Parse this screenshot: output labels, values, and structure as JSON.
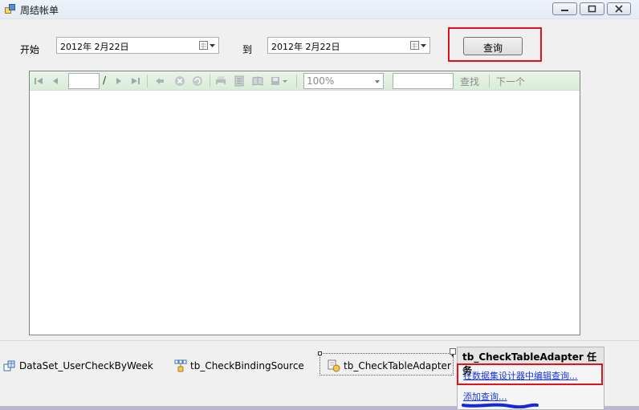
{
  "window": {
    "title": "周结帐单",
    "min_icon": "minimize-icon",
    "max_icon": "maximize-icon",
    "close_icon": "close-icon"
  },
  "filter": {
    "start_label": "开始",
    "start_date": "2012年  2月22日",
    "to_label": "到",
    "end_date": "2012年  2月22日",
    "query_button": "查询"
  },
  "report_viewer": {
    "page_number": "",
    "page_separator": "/",
    "zoom": "100%",
    "find_text": "",
    "find_label": "查找",
    "next_label": "下一个",
    "toolbar_icons": [
      "first-page-icon",
      "prev-page-icon",
      "next-page-icon",
      "last-page-icon",
      "back-icon",
      "stop-icon",
      "refresh-icon",
      "print-icon",
      "print-layout-icon",
      "page-setup-icon",
      "export-icon"
    ]
  },
  "tray": {
    "components": [
      "DataSet_UserCheckByWeek",
      "tb_CheckBindingSource",
      "tb_CheckTableAdapter"
    ]
  },
  "smart_tag": {
    "title": "tb_CheckTableAdapter 任务",
    "edit_link": "在数据集设计器中编辑查询...",
    "add_link": "添加查询..."
  },
  "colors": {
    "highlight": "#e0121b",
    "toolbar_green": "#d9ecd9",
    "link": "#1a36d8"
  }
}
